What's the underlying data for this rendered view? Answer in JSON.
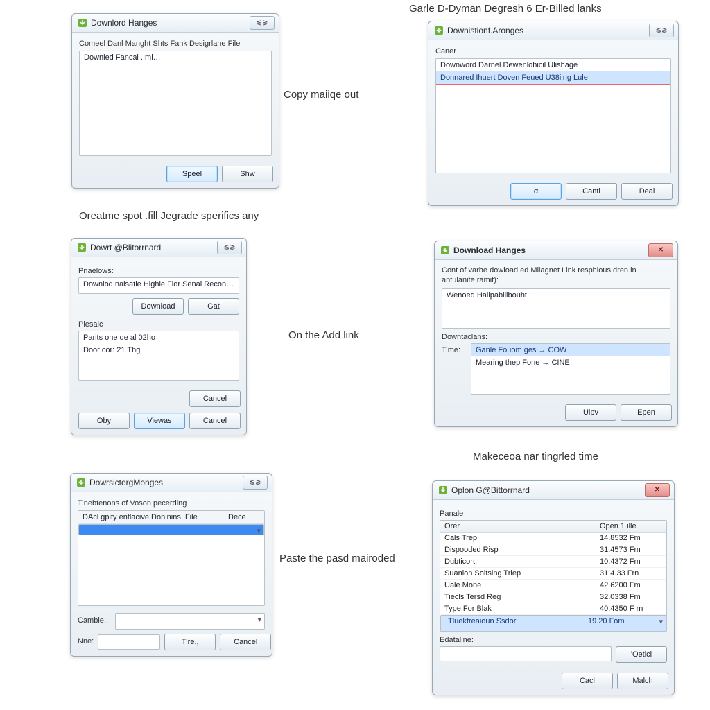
{
  "captions": {
    "c1": "Copy maiiqe out",
    "c2": "Garle D-Dyman Degresh 6 Er-Billed lanks",
    "c3": "Oreatme spot .fill Jegrade sperifics any",
    "c4": "On the Add link",
    "c5": "Makeceoa nar tingrled time",
    "c6": "Paste the pasd mairoded"
  },
  "d1": {
    "title": "Downlord Hanges",
    "close": "⫹⫺",
    "label": "Comeel Danl Manght Shts Fank Desigrlane File",
    "item1": "Downled Fancal .Iml…",
    "btn1": "Speel",
    "btn2": "Shw"
  },
  "d2": {
    "title": "Downistionf.Aronges",
    "close": "⫹⫺",
    "label": "Caner",
    "item1": "Downword Darnel Dewenlohicil Ulishage",
    "item2": "Donnared Ihuert Doven Feued U38ilng Lule",
    "btn1": "α",
    "btn2": "Cantl",
    "btn3": "Deal"
  },
  "d3": {
    "title": "Dowrt @Blitorrnard",
    "close": "⫹⫺",
    "sect1": "Pnaelows:",
    "item1": "Downlod nalsatie Highle Flor Senal Recond (PN<)",
    "btnDl": "Download",
    "btnGat": "Gat",
    "sect2": "Plesalc",
    "line1": "Parits one de al 02ho",
    "line2": "Door cor: 21 Thg",
    "btnCancel": "Cancel",
    "btnOby": "Oby",
    "btnView": "Viewas",
    "btnCancel2": "Cancel"
  },
  "d4": {
    "title": "Download Hanges",
    "close": "✕",
    "label": "Cont of varbe dowload ed Milagnet Link resphious dren in antulanite ramit):",
    "item1": "Wenoed Hallpablilbouht:",
    "sect2": "Downtaclans:",
    "timeLbl": "Time:",
    "line1": "Ganle Fouom ges → COW",
    "line2": "Mearing thep Fone → CINE",
    "btn1": "Uipv",
    "btn2": "Epen"
  },
  "d5": {
    "title": "DowrsictorgMonges",
    "close": "⫹⫺",
    "label": "Tinebtenons of Voson pecerding",
    "col1": "DAcl gpity enflacive Doninins, File",
    "col2": "Dece",
    "item1": "",
    "camLbl": "Camble..",
    "nneLbl": "Nne:",
    "btn1": "Tire.,",
    "btn2": "Cancel"
  },
  "d6": {
    "title": "Oplon G@Bittorrnard",
    "close": "✕",
    "sect": "Panale",
    "hdr1": "Orer",
    "hdr2": "Open 1 ille",
    "rows": [
      {
        "n": "Cals Trep",
        "v": "14.8532 Fm"
      },
      {
        "n": "Dispooded Risp",
        "v": "31.4573 Fm"
      },
      {
        "n": "Dubticort:",
        "v": "10.4372 Fm"
      },
      {
        "n": "Suanion Soltsing Trlep",
        "v": "31 4.33 Frn"
      },
      {
        "n": "Uale Mone",
        "v": "42 6200 Fm"
      },
      {
        "n": "Tiecls Tersd Reg",
        "v": "32.0338 Fm"
      },
      {
        "n": "Type For Blak",
        "v": "40.4350 F rn"
      },
      {
        "n": "Tluekfreaioun Ssdor",
        "v": "19.20 Fom"
      }
    ],
    "exLbl": "Edataline:",
    "btnO": "'Oeticl",
    "btn1": "Cacl",
    "btn2": "Malch"
  }
}
